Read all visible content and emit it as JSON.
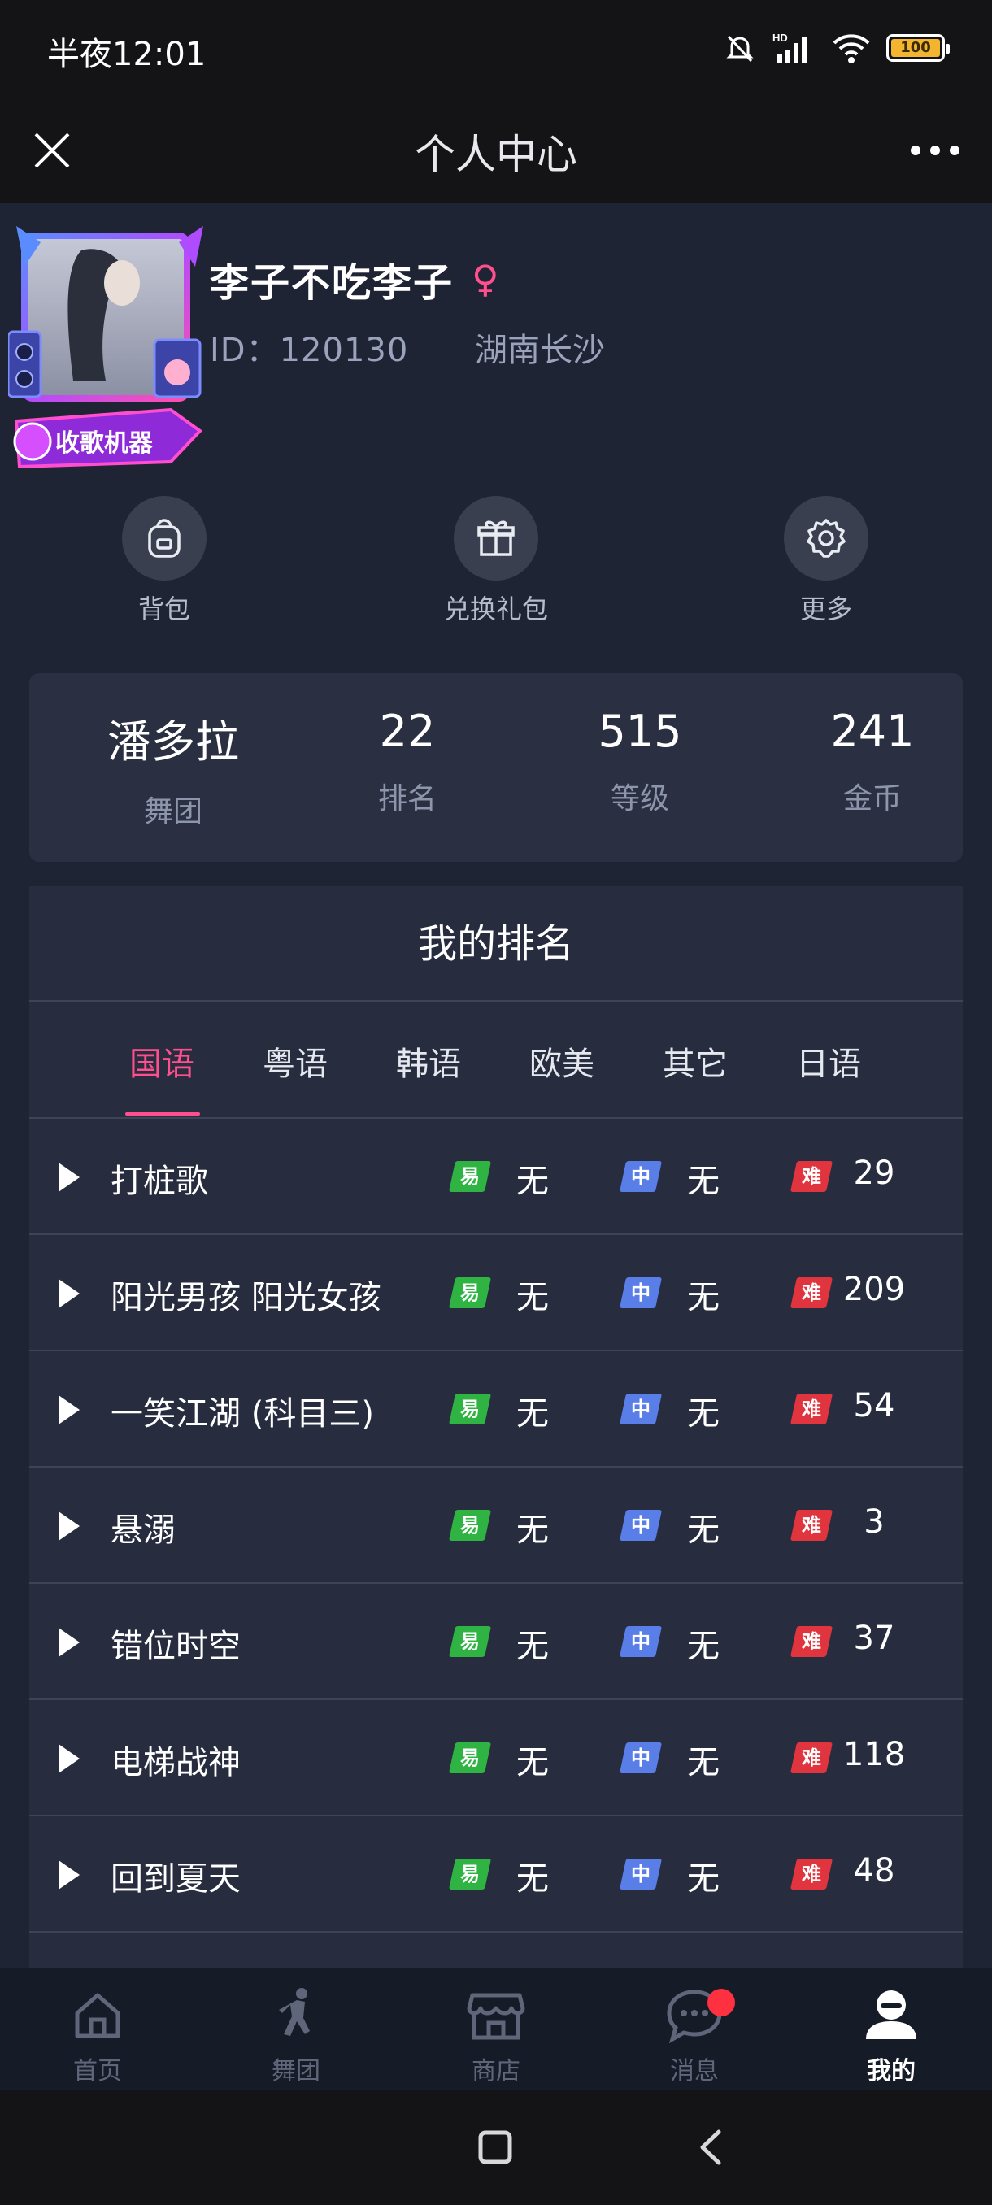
{
  "status_bar": {
    "time": "半夜12:01",
    "battery": "100"
  },
  "header": {
    "title": "个人中心"
  },
  "profile": {
    "username": "李子不吃李子",
    "gender": "♀",
    "id": "ID：120130",
    "location": "湖南长沙",
    "frame_badge": "收歌机器"
  },
  "quick_actions": [
    {
      "label": "背包",
      "icon": "backpack-icon"
    },
    {
      "label": "兑换礼包",
      "icon": "gift-icon"
    },
    {
      "label": "更多",
      "icon": "gear-icon"
    }
  ],
  "stats": [
    {
      "value": "潘多拉",
      "label": "舞团"
    },
    {
      "value": "22",
      "label": "排名"
    },
    {
      "value": "515",
      "label": "等级"
    },
    {
      "value": "241",
      "label": "金币"
    }
  ],
  "ranking": {
    "title": "我的排名",
    "tabs": [
      "国语",
      "粤语",
      "韩语",
      "欧美",
      "其它",
      "日语"
    ],
    "active_tab": "国语",
    "difficulty_labels": {
      "easy": "易",
      "mid": "中",
      "hard": "难"
    },
    "songs": [
      {
        "name": "打桩歌",
        "easy": "无",
        "mid": "无",
        "hard": "29"
      },
      {
        "name": "阳光男孩 阳光女孩",
        "easy": "无",
        "mid": "无",
        "hard": "209"
      },
      {
        "name": "一笑江湖 (科目三)",
        "easy": "无",
        "mid": "无",
        "hard": "54"
      },
      {
        "name": "悬溺",
        "easy": "无",
        "mid": "无",
        "hard": "3"
      },
      {
        "name": "错位时空",
        "easy": "无",
        "mid": "无",
        "hard": "37"
      },
      {
        "name": "电梯战神",
        "easy": "无",
        "mid": "无",
        "hard": "118"
      },
      {
        "name": "回到夏天",
        "easy": "无",
        "mid": "无",
        "hard": "48"
      }
    ]
  },
  "bottom_nav": [
    {
      "label": "首页",
      "icon": "home-icon"
    },
    {
      "label": "舞团",
      "icon": "dancer-icon"
    },
    {
      "label": "商店",
      "icon": "store-icon"
    },
    {
      "label": "消息",
      "icon": "message-icon"
    },
    {
      "label": "我的",
      "icon": "profile-icon"
    }
  ],
  "colors": {
    "accent": "#ff4f8e",
    "easy": "#2fb444",
    "mid": "#5a7ee8",
    "hard": "#e0353e"
  }
}
